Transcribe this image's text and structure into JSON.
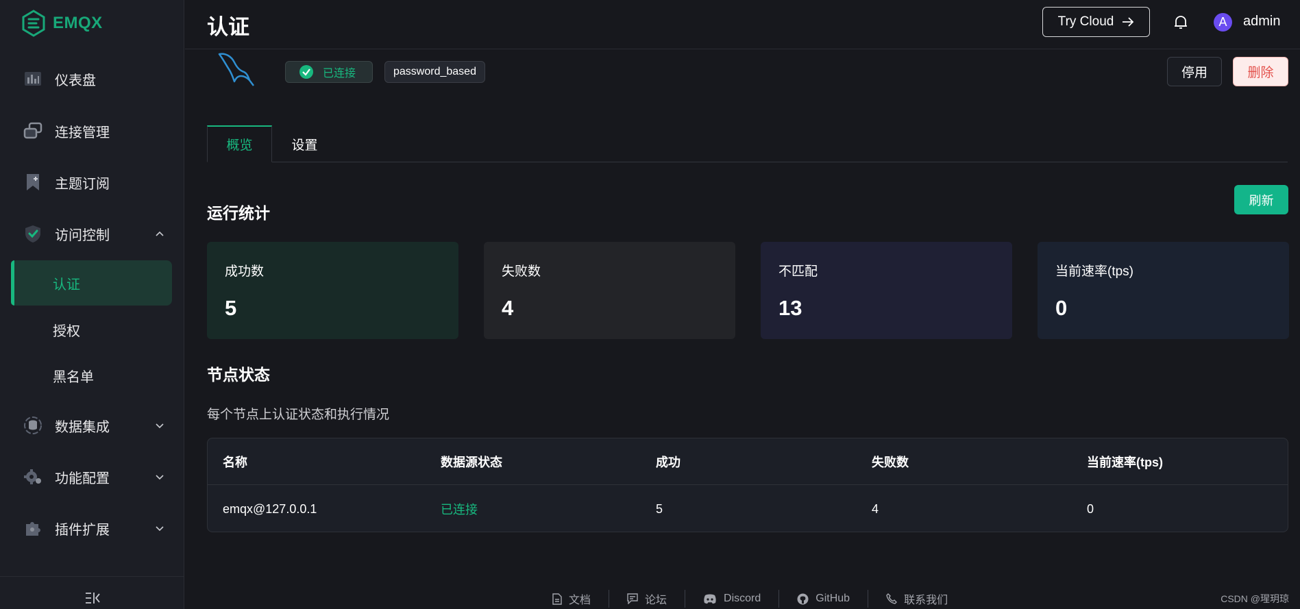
{
  "app": {
    "brand": "EMQX",
    "brand_color": "#18a879"
  },
  "sidebar": {
    "items": [
      {
        "label": "仪表盘",
        "icon": "dashboard-icon"
      },
      {
        "label": "连接管理",
        "icon": "connections-icon"
      },
      {
        "label": "主题订阅",
        "icon": "subscriptions-icon"
      },
      {
        "label": "访问控制",
        "icon": "shield-check-icon",
        "expanded": true
      },
      {
        "label": "数据集成",
        "icon": "data-integration-icon"
      },
      {
        "label": "功能配置",
        "icon": "settings-gear-icon"
      },
      {
        "label": "插件扩展",
        "icon": "plugin-icon"
      }
    ],
    "sub_items": [
      {
        "label": "认证",
        "active": true
      },
      {
        "label": "授权"
      },
      {
        "label": "黑名单"
      }
    ]
  },
  "header": {
    "title": "认证",
    "try_cloud": "Try Cloud",
    "avatar_letter": "A",
    "username": "admin"
  },
  "authenticator": {
    "status": "已连接",
    "mechanism": "password_based",
    "disable_label": "停用",
    "delete_label": "删除"
  },
  "tabs": [
    {
      "label": "概览",
      "active": true
    },
    {
      "label": "设置"
    }
  ],
  "stats_section": {
    "title": "运行统计",
    "refresh_label": "刷新",
    "cards": [
      {
        "label": "成功数",
        "value": "5",
        "bg": "#182a27"
      },
      {
        "label": "失败数",
        "value": "4",
        "bg": "#232428"
      },
      {
        "label": "不匹配",
        "value": "13",
        "bg": "#1f2034"
      },
      {
        "label": "当前速率(tps)",
        "value": "0",
        "bg": "#1b2230"
      }
    ]
  },
  "nodes_section": {
    "title": "节点状态",
    "description": "每个节点上认证状态和执行情况",
    "columns": [
      "名称",
      "数据源状态",
      "成功",
      "失败数",
      "当前速率(tps)"
    ],
    "rows": [
      {
        "name": "emqx@127.0.0.1",
        "status": "已连接",
        "success": "5",
        "failed": "4",
        "rate": "0"
      }
    ]
  },
  "footer": {
    "links": [
      {
        "label": "文档",
        "icon": "document-icon"
      },
      {
        "label": "论坛",
        "icon": "forum-icon"
      },
      {
        "label": "Discord",
        "icon": "discord-icon"
      },
      {
        "label": "GitHub",
        "icon": "github-icon"
      },
      {
        "label": "联系我们",
        "icon": "phone-icon"
      }
    ],
    "watermark": "CSDN @瑆玥琼"
  }
}
